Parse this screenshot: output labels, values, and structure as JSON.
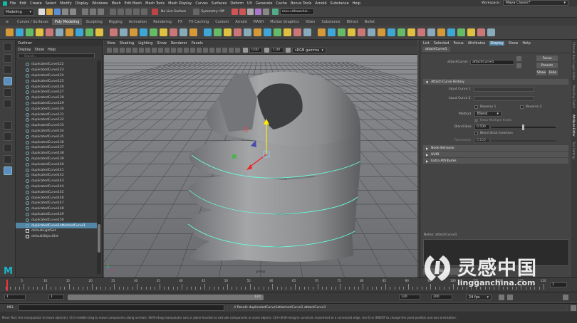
{
  "menubar": {
    "items": [
      "File",
      "Edit",
      "Create",
      "Select",
      "Modify",
      "Display",
      "Windows",
      "Mesh",
      "Edit Mesh",
      "Mesh Tools",
      "Mesh Display",
      "Curves",
      "Surfaces",
      "Deform",
      "UV",
      "Generate",
      "Cache",
      "Bonus Tools",
      "Arnold",
      "Substance",
      "Help"
    ],
    "workspace_label": "Workspace :",
    "workspace_value": "Maya Classic*"
  },
  "status": {
    "mode_value": "Modeling",
    "live_surface": "No Live Surface",
    "symmetry": "Symmetry: Off",
    "field_value": "max.cdhownher..."
  },
  "shelf_tabs": {
    "items": [
      "Curves / Surfaces",
      "Poly Modeling",
      "Sculpting",
      "Rigging",
      "Animation",
      "Rendering",
      "FX",
      "FX Caching",
      "Custom",
      "Arnold",
      "MASH",
      "Motion Graphics",
      "XGen",
      "Substance",
      "Bifrost",
      "Bullet"
    ],
    "active_index": 1
  },
  "outliner": {
    "title": "Outliner",
    "menu": [
      "Display",
      "Show",
      "Help"
    ],
    "search_placeholder": "Search...",
    "items": [
      "duplicatedCurve122",
      "duplicatedCurve123",
      "duplicatedCurve124",
      "duplicatedCurve125",
      "duplicatedCurve126",
      "duplicatedCurve127",
      "duplicatedCurve128",
      "duplicatedCurve129",
      "duplicatedCurve130",
      "duplicatedCurve131",
      "duplicatedCurve132",
      "duplicatedCurve133",
      "duplicatedCurve134",
      "duplicatedCurve135",
      "duplicatedCurve136",
      "duplicatedCurve137",
      "duplicatedCurve138",
      "duplicatedCurve139",
      "duplicatedCurve140",
      "duplicatedCurve141",
      "duplicatedCurve142",
      "duplicatedCurve143",
      "duplicatedCurve144",
      "duplicatedCurve145",
      "duplicatedCurve146",
      "duplicatedCurve147",
      "duplicatedCurve148",
      "duplicatedCurve149",
      "duplicatedCurve150",
      "duplicatedCurve1attachedCurve1",
      "defaultLightSet",
      "defaultObjectSet"
    ],
    "selected_index": 29
  },
  "viewport": {
    "menu": [
      "View",
      "Shading",
      "Lighting",
      "Show",
      "Renderer",
      "Panels"
    ],
    "field1": "0.00",
    "field2": "1.00",
    "colorspace": "sRGB gamma",
    "camera_label": "persp"
  },
  "attr_editor": {
    "menu": [
      "List",
      "Selected",
      "Focus",
      "Attributes",
      "Display",
      "Show",
      "Help"
    ],
    "node_tab": "attachCurve1",
    "node_label": "attachCurve:",
    "node_value": "attachCurve1",
    "focus_btn": "Focus",
    "presets_btn": "Presets",
    "show_btn": "Show",
    "hide_btn": "Hide",
    "section_history": "Attach Curve History",
    "input_curve1": "Input Curve 1",
    "input_curve2": "Input Curve 2",
    "reverse1": "Reverse 1",
    "reverse2": "Reverse 2",
    "method_label": "Method",
    "method_value": "Blend",
    "keep_knots": "Keep Multiple Knots",
    "blend_bias_label": "Blend Bias",
    "blend_bias_value": "0.500",
    "blend_knot": "Blend Knot Insertion",
    "parameter_label": "Parameter",
    "parameter_value": "0.100",
    "section_node_behavior": "Node Behavior",
    "section_uuid": "UUID",
    "section_extra": "Extra Attributes",
    "notes_label": "Notes: attachCurve1",
    "select_btn": "Select"
  },
  "sidetabs": [
    "Channel Box / Layer Editor",
    "Modeling Toolkit",
    "Attribute Editor",
    "Tool Settings"
  ],
  "time": {
    "ticks": [
      "5",
      "10",
      "15",
      "20",
      "25",
      "30",
      "35",
      "40",
      "45",
      "50",
      "55",
      "60",
      "65",
      "70",
      "75",
      "80",
      "85",
      "90",
      "95",
      "100",
      "105",
      "110",
      "115",
      "120"
    ],
    "current_frame": "1",
    "range_start": "1",
    "range_inner_start": "1",
    "range_inner_end": "120",
    "range_end_a": "120",
    "range_end_b": "200",
    "fps": "24 fps"
  },
  "cmd": {
    "mel_label": "MEL",
    "result": "// Result: duplicatedCurve1attachedCurve1 attachCurve1"
  },
  "helpline": "Move Tool: Use manipulator to move object(s). Ctrl+middle-drag to move components along normals. Shift+drag manipulator axis or plane handles to extrude components or clone objects. Ctrl+Shift+drag to constrain movement to a connected edge. Use D or INSERT to change the pivot position and axis orientation.",
  "watermark": {
    "cn": "灵感中国",
    "url": "lingganchina.com"
  }
}
